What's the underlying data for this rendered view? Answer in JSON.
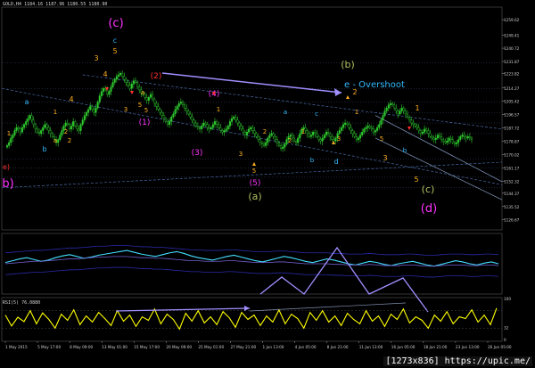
{
  "header": {
    "symbol": "GOLD,H4",
    "ohlc": "1184.16 1187.96 1180.55 1180.90"
  },
  "rsi_header": "RSI(5) 76.0880",
  "watermark": "[1273x836] https://upic.me/",
  "colors": {
    "bull_candle": "#2ecc2e",
    "bear_candle": "#2ecc2e",
    "magenta": "#ff33ff",
    "olive": "#b0c060",
    "cyan": "#33bbff",
    "orange": "#ffb020",
    "red": "#ff3030",
    "lavender": "#9f8fff",
    "rsi": "#ffff00",
    "osc": "#44ddff"
  },
  "chart_data": [
    {
      "type": "line",
      "name": "price",
      "title": "GOLD,H4",
      "ylim": [
        1120,
        1268
      ],
      "y_ticks": [
        "1259.62",
        "1249.41",
        "1240.72",
        "1231.87",
        "1223.82",
        "1214.27",
        "1205.42",
        "1196.57",
        "1187.72",
        "1178.87",
        "1170.02",
        "1161.17",
        "1152.32",
        "1144.37",
        "1135.52",
        "1126.67"
      ],
      "x_ticks": [
        "1 May 2015",
        "5 May 17:00",
        "8 May 09:00",
        "13 May 01:00",
        "15 May 17:00",
        "20 May 09:00",
        "25 May 01:00",
        "27 May 21:00",
        "1 Jun 13:00",
        "4 Jun 05:00",
        "8 Jun 21:00",
        "11 Jun 13:00",
        "16 Jun 05:00",
        "18 Jun 21:00",
        "23 Jun 13:00",
        "26 Jun 05:00"
      ],
      "x": [
        0,
        1,
        2,
        3,
        4,
        5,
        6,
        7,
        8,
        9,
        10,
        11,
        12,
        13,
        14,
        15,
        16,
        17,
        18,
        19,
        20,
        21,
        22,
        23,
        24,
        25,
        26,
        27,
        28,
        29,
        30,
        31,
        32,
        33,
        34,
        35,
        36,
        37,
        38,
        39,
        40,
        41,
        42,
        43,
        44,
        45,
        46,
        47,
        48,
        49,
        50,
        51,
        52,
        53,
        54,
        55,
        56,
        57,
        58,
        59,
        60,
        61,
        62,
        63,
        64,
        65,
        66,
        67,
        68,
        69,
        70,
        71,
        72,
        73,
        74,
        75,
        76,
        77,
        78,
        79,
        80,
        81,
        82,
        83,
        84,
        85,
        86,
        87,
        88,
        89,
        90,
        91,
        92,
        93,
        94,
        95,
        96,
        97,
        98,
        99,
        100,
        101,
        102,
        103,
        104,
        105,
        106,
        107,
        108,
        109,
        110,
        111,
        112,
        113,
        114,
        115,
        116,
        117,
        118,
        119,
        120,
        121,
        122,
        123,
        124,
        125,
        126,
        127,
        128,
        129,
        130,
        131,
        132,
        133,
        134,
        135,
        136,
        137,
        138,
        139,
        140,
        141,
        142,
        143,
        144,
        145,
        146,
        147,
        148,
        149,
        150,
        151,
        152,
        153,
        154,
        155,
        156,
        157,
        158,
        159,
        160,
        161,
        162,
        163,
        164,
        165,
        166,
        167,
        168,
        169,
        170,
        171,
        172,
        173,
        174,
        175,
        176,
        177,
        178,
        179,
        180,
        181,
        182,
        183,
        184,
        185,
        186,
        187,
        188,
        189,
        190,
        191,
        192,
        193,
        194,
        195,
        196,
        197,
        198,
        199,
        200,
        201,
        202,
        203,
        204,
        205,
        206,
        207,
        208,
        209,
        210,
        211,
        212,
        213,
        214,
        215,
        216,
        217,
        218,
        219,
        220,
        221,
        222,
        223,
        224,
        225,
        226,
        227,
        228,
        229,
        230,
        231,
        232,
        233,
        234,
        235,
        236,
        237,
        238,
        239,
        240,
        241,
        242,
        243,
        244,
        245,
        246,
        247,
        248,
        249
      ],
      "close": [
        1176,
        1178,
        1181,
        1183,
        1186,
        1188,
        1187,
        1185,
        1188,
        1190,
        1192,
        1194,
        1196,
        1193,
        1190,
        1187,
        1185,
        1184,
        1186,
        1188,
        1190,
        1188,
        1186,
        1184,
        1182,
        1180,
        1178,
        1180,
        1183,
        1186,
        1189,
        1191,
        1190,
        1187,
        1189,
        1192,
        1189,
        1187,
        1186,
        1190,
        1193,
        1196,
        1198,
        1200,
        1202,
        1200,
        1198,
        1201,
        1205,
        1209,
        1212,
        1214,
        1213,
        1210,
        1212,
        1215,
        1218,
        1220,
        1222,
        1223,
        1224,
        1222,
        1220,
        1218,
        1216,
        1214,
        1217,
        1219,
        1218,
        1215,
        1213,
        1211,
        1210,
        1208,
        1206,
        1208,
        1210,
        1207,
        1204,
        1202,
        1200,
        1198,
        1196,
        1194,
        1192,
        1190,
        1192,
        1195,
        1197,
        1200,
        1202,
        1204,
        1205,
        1203,
        1201,
        1199,
        1197,
        1195,
        1193,
        1191,
        1189,
        1188,
        1187,
        1189,
        1191,
        1190,
        1188,
        1187,
        1188,
        1190,
        1192,
        1190,
        1188,
        1186,
        1185,
        1186,
        1187,
        1189,
        1192,
        1194,
        1195,
        1193,
        1191,
        1189,
        1187,
        1185,
        1183,
        1185,
        1187,
        1188,
        1186,
        1184,
        1182,
        1180,
        1178,
        1177,
        1176,
        1178,
        1181,
        1183,
        1184,
        1182,
        1180,
        1178,
        1176,
        1174,
        1175,
        1177,
        1180,
        1182,
        1183,
        1181,
        1179,
        1178,
        1181,
        1184,
        1187,
        1188,
        1186,
        1184,
        1182,
        1183,
        1185,
        1184,
        1182,
        1180,
        1179,
        1181,
        1183,
        1185,
        1184,
        1182,
        1180,
        1179,
        1181,
        1184,
        1186,
        1188,
        1190,
        1191,
        1190,
        1188,
        1186,
        1184,
        1182,
        1180,
        1181,
        1183,
        1185,
        1187,
        1188,
        1189,
        1188,
        1187,
        1185,
        1186,
        1188,
        1190,
        1193,
        1196,
        1199,
        1201,
        1203,
        1204,
        1203,
        1201,
        1199,
        1197,
        1199,
        1201,
        1199,
        1197,
        1195,
        1193,
        1191,
        1190,
        1189,
        1188,
        1186,
        1184,
        1185,
        1187,
        1186,
        1184,
        1182,
        1181,
        1180,
        1181,
        1183,
        1182,
        1180,
        1179,
        1178,
        1179,
        1181,
        1180,
        1178,
        1177,
        1178,
        1180,
        1182,
        1183,
        1182,
        1181,
        1182,
        1181,
        1180
      ]
    },
    {
      "type": "line",
      "name": "oscillator",
      "ylim": [
        0,
        100
      ],
      "series": [
        {
          "values": [
            52,
            55,
            58,
            60,
            57,
            54,
            56,
            60,
            63,
            65,
            62,
            59,
            61,
            64,
            66,
            68,
            70,
            72,
            69,
            66,
            64,
            62,
            65,
            68,
            70,
            67,
            63,
            60,
            58,
            56,
            59,
            62,
            64,
            61,
            58,
            55,
            53,
            56,
            59,
            62,
            60,
            57,
            54,
            52,
            55,
            58,
            56,
            53,
            50,
            48,
            51,
            54,
            52,
            49,
            47,
            50,
            52,
            54,
            51,
            48,
            46,
            49,
            52,
            55,
            53,
            50,
            48,
            51,
            53,
            50
          ]
        },
        {
          "values": [
            50,
            51,
            52,
            53,
            54,
            54,
            55,
            56,
            57,
            58,
            58,
            59,
            60,
            61,
            61,
            62,
            62,
            62,
            61,
            60,
            60,
            59,
            59,
            58,
            57,
            56,
            55,
            55,
            54,
            54,
            54,
            55,
            55,
            54,
            53,
            52,
            52,
            52,
            53,
            53,
            52,
            51,
            50,
            50,
            50,
            50,
            49,
            49,
            48,
            48,
            48,
            49,
            48,
            47,
            47,
            47,
            48,
            48,
            47,
            46,
            46,
            47,
            48,
            48,
            48,
            47,
            47,
            48,
            48,
            47
          ]
        }
      ]
    },
    {
      "type": "line",
      "name": "rsi",
      "title": "RSI(5) 76.0880",
      "ylim": [
        0,
        100
      ],
      "y_ticks": [
        "100",
        "32",
        "0"
      ],
      "values": [
        60,
        35,
        55,
        45,
        70,
        40,
        65,
        50,
        30,
        62,
        48,
        72,
        38,
        58,
        44,
        66,
        52,
        36,
        70,
        46,
        60,
        34,
        56,
        48,
        74,
        40,
        62,
        50,
        28,
        64,
        46,
        70,
        42,
        56,
        38,
        68,
        54,
        32,
        66,
        50,
        60,
        36,
        58,
        44,
        72,
        40,
        62,
        52,
        30,
        66,
        48,
        70,
        44,
        58,
        36,
        64,
        50,
        40,
        70,
        46,
        58,
        34,
        62,
        50,
        74,
        42,
        56,
        48,
        30,
        60,
        46,
        68,
        40,
        56,
        52,
        72,
        44,
        60,
        38,
        76
      ]
    }
  ],
  "wave_labels": [
    {
      "text": "(c)",
      "color": "magenta",
      "size": 13
    },
    {
      "text": "c",
      "color": "cyan",
      "size": 8
    },
    {
      "text": "5",
      "color": "orange",
      "size": 8
    },
    {
      "text": "3",
      "color": "orange",
      "size": 8
    },
    {
      "text": "4",
      "color": "orange",
      "size": 8
    },
    {
      "text": "(2)",
      "color": "red",
      "size": 9
    },
    {
      "text": "(4)",
      "color": "magenta",
      "size": 9
    },
    {
      "text": "(1)",
      "color": "magenta",
      "size": 9
    },
    {
      "text": "(3)",
      "color": "magenta",
      "size": 9
    },
    {
      "text": "(5)",
      "color": "magenta",
      "size": 9
    },
    {
      "text": "(a)",
      "color": "olive",
      "size": 11
    },
    {
      "text": "(b)",
      "color": "olive",
      "size": 11
    },
    {
      "text": "(c)",
      "color": "olive",
      "size": 11
    },
    {
      "text": "(d)",
      "color": "magenta",
      "size": 13
    },
    {
      "text": "b)",
      "color": "magenta",
      "size": 13
    },
    {
      "text": "e)",
      "color": "red",
      "size": 8
    },
    {
      "text": "e - Overshoot",
      "color": "cyan",
      "size": 10
    },
    {
      "text": "a",
      "color": "cyan",
      "size": 8
    },
    {
      "text": "b",
      "color": "cyan",
      "size": 8
    },
    {
      "text": "d",
      "color": "cyan",
      "size": 8
    },
    {
      "text": "1",
      "color": "orange",
      "size": 8
    },
    {
      "text": "2",
      "color": "orange",
      "size": 8
    },
    {
      "text": "3",
      "color": "orange",
      "size": 8
    },
    {
      "text": "4",
      "color": "orange",
      "size": 8
    },
    {
      "text": "5",
      "color": "orange",
      "size": 8
    }
  ]
}
